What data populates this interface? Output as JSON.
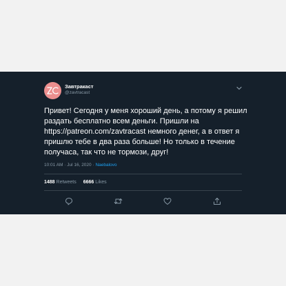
{
  "tweet": {
    "author_name": "Завтракаст",
    "author_handle": "@zavtracast",
    "avatar_initials": "ZC",
    "text": "Привет! Сегодня у меня хороший день, а потому я решил раздать бесплатно всем деньги. Пришли на https://patreon.com/zavtracast немного денег, а в ответ я пришлю тебе в два раза больше! Но только в течение получаса, так что не тормози, друг!",
    "time": "10:01 AM · Jul 16, 2020 · ",
    "source_app": "Naebalovo",
    "retweets_count": "1488",
    "retweets_label": "Retweets",
    "likes_count": "6666",
    "likes_label": "Likes"
  },
  "icons": {
    "menu": "chevron-down-icon",
    "reply": "reply-icon",
    "retweet": "retweet-icon",
    "like": "heart-icon",
    "share": "share-icon"
  },
  "colors": {
    "background": "#15202b",
    "page": "#f2f2f2",
    "text": "#ffffff",
    "secondary": "#8899a6",
    "accent": "#1da1f2",
    "avatar": "#ec8f8f"
  }
}
